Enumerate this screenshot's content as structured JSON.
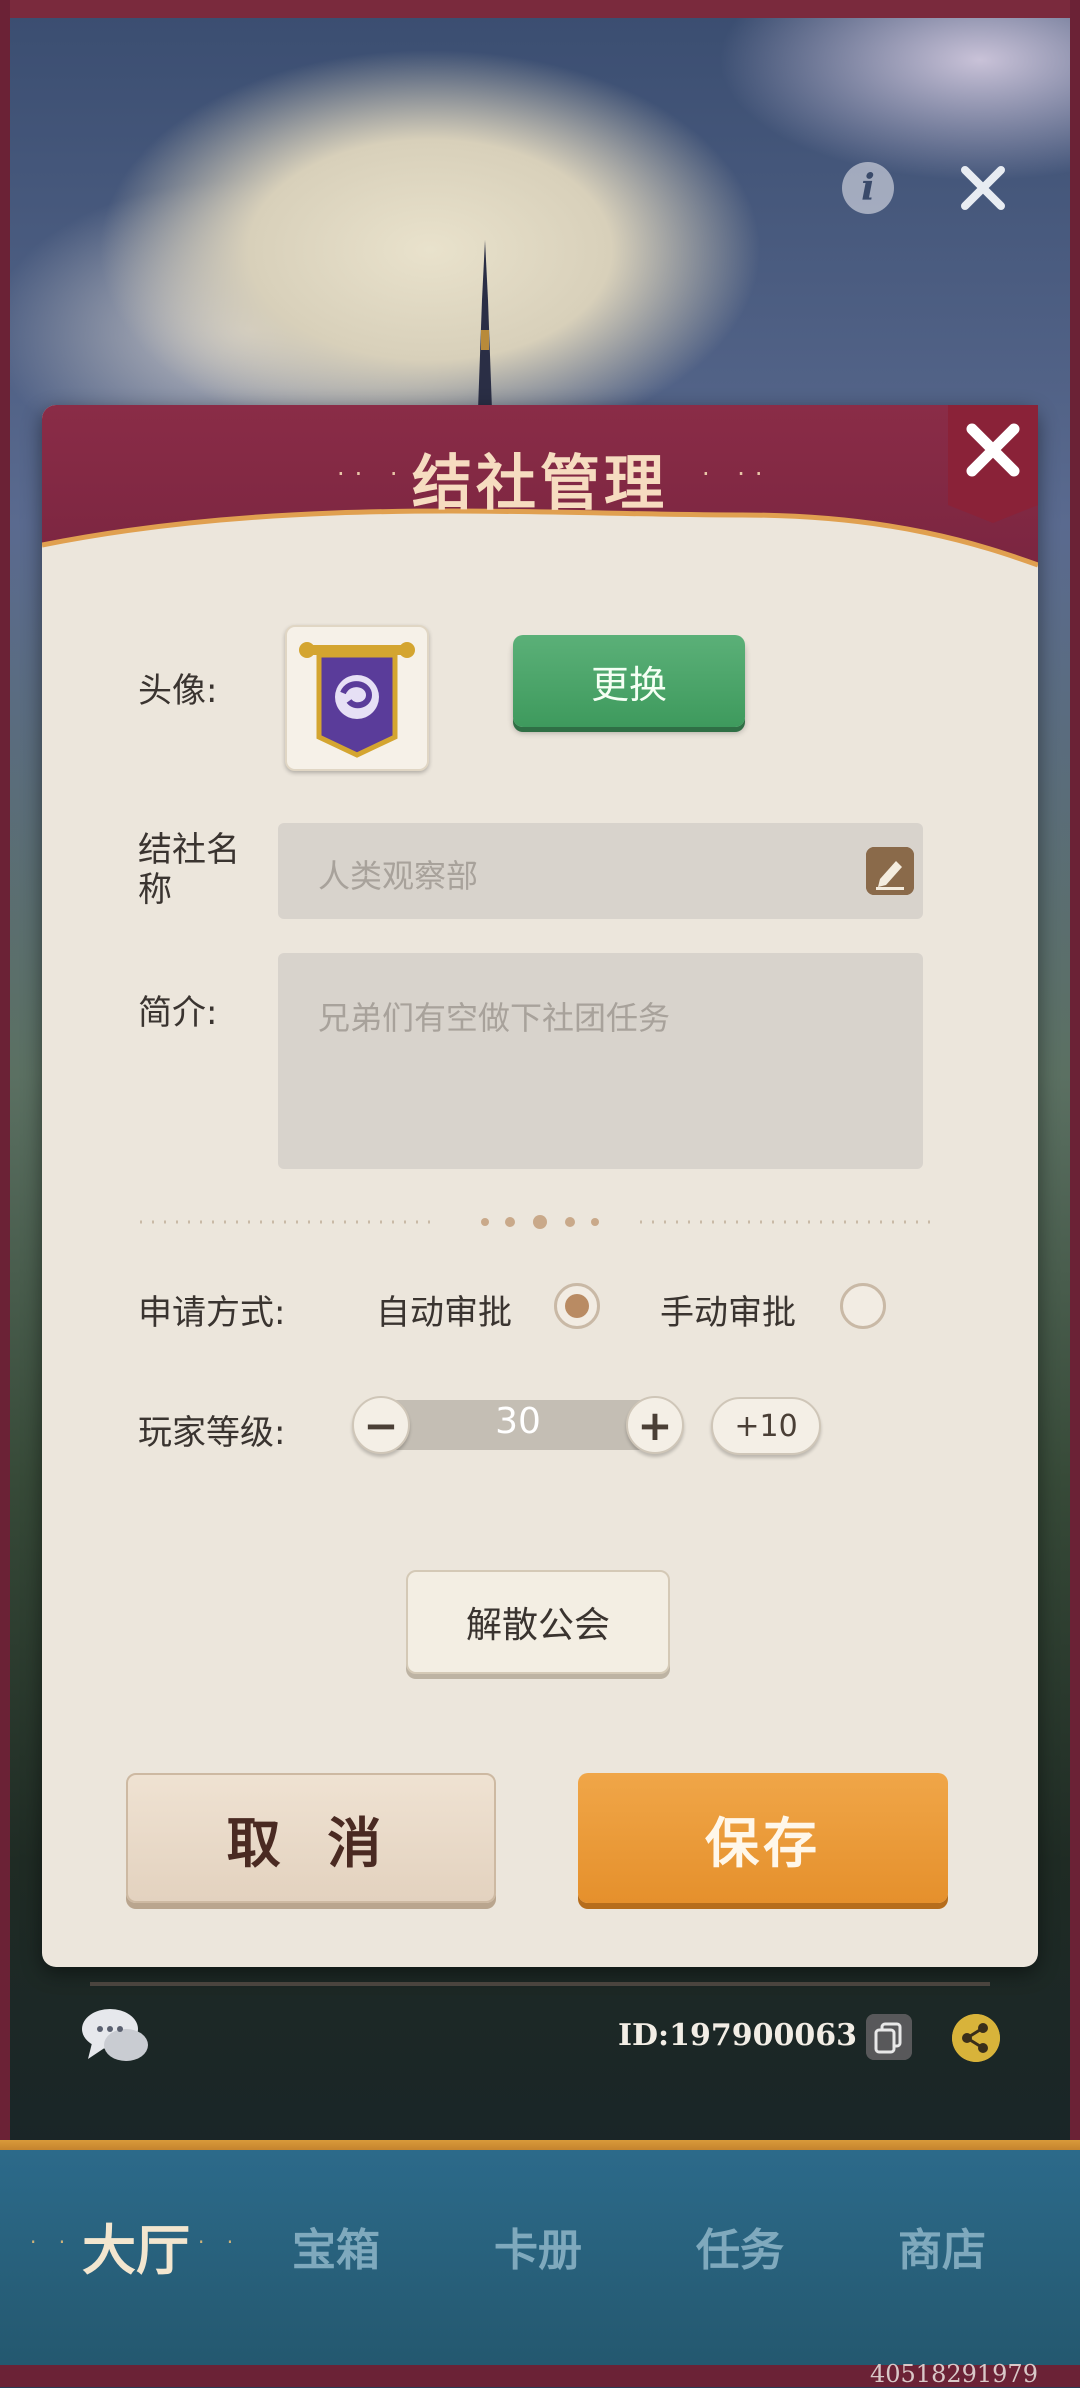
{
  "dialog": {
    "title": "结社管理",
    "avatar_label": "头像:",
    "change_button": "更换",
    "name_label": "结社名称",
    "name_placeholder": "人类观察部",
    "intro_label": "简介:",
    "intro_placeholder": "兄弟们有空做下社团任务",
    "apply_label": "申请方式:",
    "auto_approve": "自动审批",
    "manual_approve": "手动审批",
    "selected_apply_mode": "auto",
    "level_label": "玩家等级:",
    "level_value": "30",
    "minus_symbol": "−",
    "plus_symbol": "+",
    "plus10_label": "+10",
    "disband_button": "解散公会",
    "cancel_button": "取 消",
    "save_button": "保存"
  },
  "footer": {
    "id_text": "ID:197900063"
  },
  "tabs": [
    {
      "label": "大厅",
      "active": true
    },
    {
      "label": "宝箱",
      "active": false
    },
    {
      "label": "卡册",
      "active": false
    },
    {
      "label": "任务",
      "active": false
    },
    {
      "label": "商店",
      "active": false
    }
  ],
  "watermark": "40518291979",
  "icons": {
    "info": "info-icon",
    "top_close": "close-icon",
    "dialog_close": "close-icon",
    "avatar": "guild-banner-icon",
    "edit": "pencil-icon",
    "chat": "chat-icon",
    "copy": "copy-icon",
    "share": "share-icon"
  },
  "colors": {
    "header": "#8a2c47",
    "change_button": "#4ea56a",
    "save_button": "#eb9b3a",
    "tabbar": "#2c6a8a"
  }
}
